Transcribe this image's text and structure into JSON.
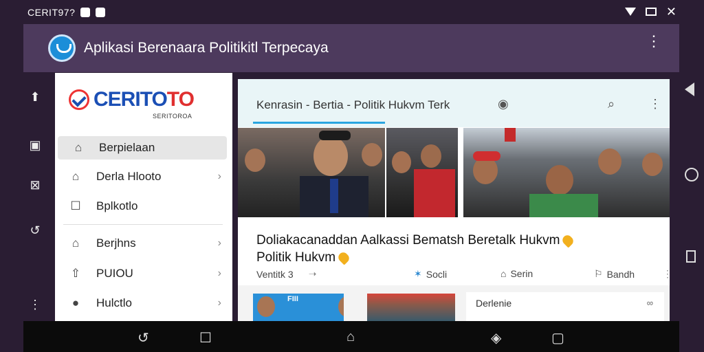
{
  "status_bar": {
    "carrier": "CERIT97?"
  },
  "app_bar": {
    "title": "Aplikasi Berenaara Politikitl Terpecaya"
  },
  "sidebar": {
    "brand_part1": "CERITO",
    "brand_part2": "TO",
    "brand_tagline": "SERITOROA",
    "items": [
      {
        "label": "Berpielaan",
        "icon": "home-icon"
      },
      {
        "label": "Derla Hlooto",
        "icon": "home-icon"
      },
      {
        "label": "Bplkotlo",
        "icon": "square-icon"
      },
      {
        "label": "Berjhns",
        "icon": "home-icon"
      },
      {
        "label": "PUIOU",
        "icon": "upload-icon"
      },
      {
        "label": "Hulctlo",
        "icon": "chat-icon"
      }
    ]
  },
  "content": {
    "tab_label": "Kenrasin   - Bertia - Politik Hukvm Terk",
    "headline_line1": "Doliakacanaddan Aalkassi Bematsh Beretalk Hukvm",
    "headline_line2": "Politik Hukvm",
    "meta": {
      "views": "Ventitk 3",
      "social": "Socli",
      "share": "Serin",
      "bookmark": "Bandh"
    },
    "side_card_label": "Derlenie",
    "thumb_caption": "FIII"
  },
  "colors": {
    "app_bar": "#4d3a5d",
    "accent": "#2aa5e0",
    "brand_blue": "#1b4fb5",
    "brand_red": "#e03030",
    "heart": "#f2b01e"
  }
}
